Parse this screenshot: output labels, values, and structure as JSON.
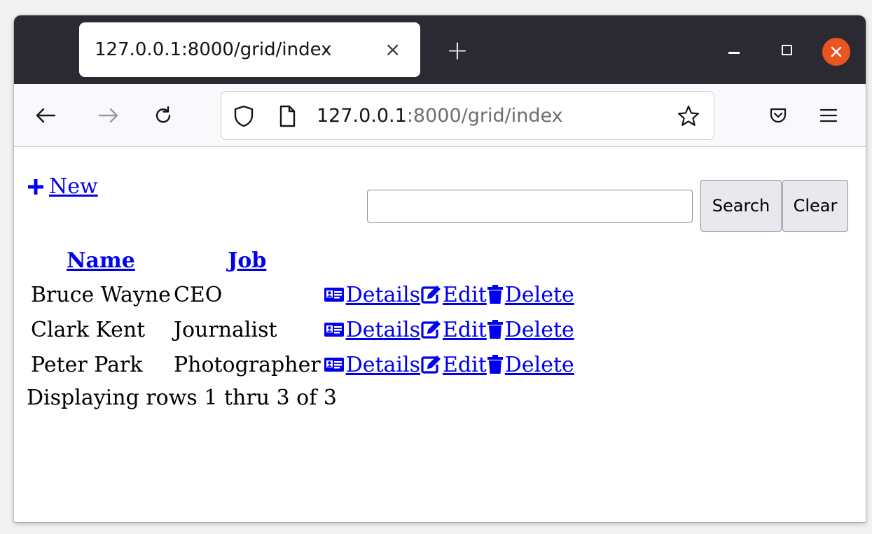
{
  "browser": {
    "tab_title": "127.0.0.1:8000/grid/index",
    "tab_close": "×",
    "new_tab": "+",
    "url_host": "127.0.0.1",
    "url_rest": ":8000/grid/index"
  },
  "page": {
    "new_label": " New",
    "search": {
      "value": "",
      "placeholder": ""
    },
    "search_button": "Search",
    "clear_button": "Clear",
    "columns": [
      "Name",
      "Job"
    ],
    "rows": [
      {
        "name": "Bruce Wayne",
        "job": "CEO"
      },
      {
        "name": "Clark Kent",
        "job": "Journalist"
      },
      {
        "name": "Peter Park",
        "job": "Photographer"
      }
    ],
    "actions": {
      "details": " Details",
      "edit": " Edit",
      "delete": " Delete"
    },
    "status": "Displaying rows 1 thru 3 of 3"
  },
  "icons": {
    "back": "arrow-left-icon",
    "forward": "arrow-right-icon",
    "reload": "reload-icon",
    "shield": "shield-icon",
    "page": "page-icon",
    "star": "star-icon",
    "pocket": "pocket-icon",
    "menu": "hamburger-menu-icon",
    "new": "plus-icon",
    "details": "id-card-icon",
    "edit": "edit-icon",
    "delete": "trash-icon"
  },
  "colors": {
    "link": "#0000ee",
    "tabbar": "#2b2a33",
    "close_button": "#e95420"
  }
}
